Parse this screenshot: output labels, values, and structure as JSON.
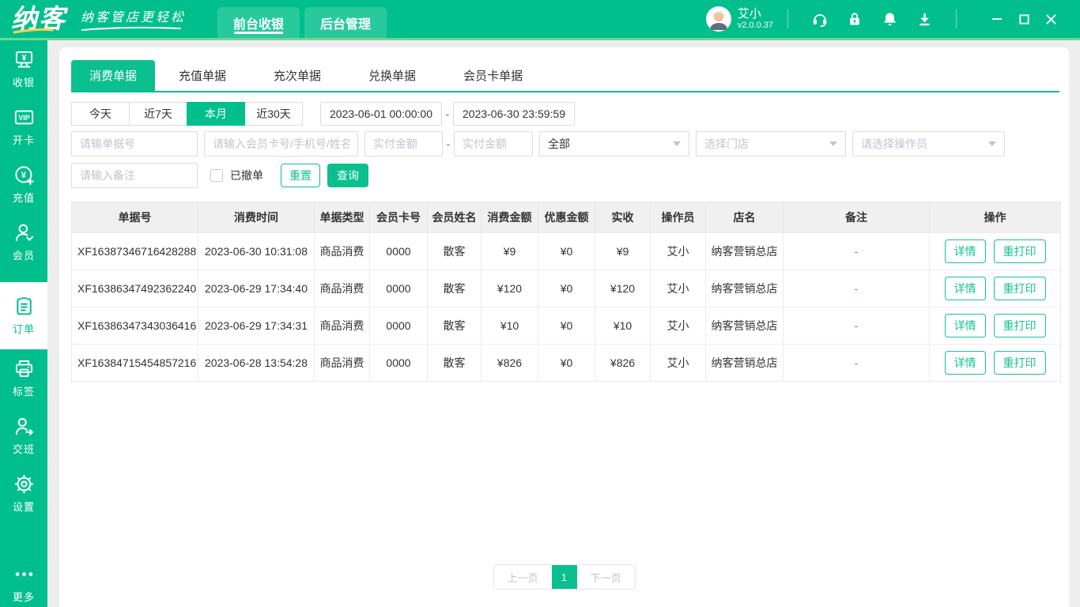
{
  "titlebar": {
    "logo": "纳客",
    "slogan": "纳客管店更轻松",
    "nav": {
      "front": "前台收银",
      "back": "后台管理"
    },
    "user": {
      "name": "艾小",
      "version": "v2.0.0.37"
    }
  },
  "sidebar": {
    "items": [
      {
        "label": "收银",
        "icon": "cash-register-icon",
        "active": false
      },
      {
        "label": "开卡",
        "icon": "vip-card-icon",
        "active": false
      },
      {
        "label": "充值",
        "icon": "recharge-icon",
        "active": false
      },
      {
        "label": "会员",
        "icon": "member-icon",
        "active": false
      },
      {
        "label": "订单",
        "icon": "order-icon",
        "active": true
      },
      {
        "label": "标签",
        "icon": "label-printer-icon",
        "active": false
      },
      {
        "label": "交班",
        "icon": "shift-icon",
        "active": false
      },
      {
        "label": "设置",
        "icon": "settings-gear-icon",
        "active": false
      },
      {
        "label": "更多",
        "icon": "more-dots-icon",
        "active": false
      }
    ]
  },
  "tabs": [
    {
      "label": "消费单据",
      "active": true
    },
    {
      "label": "充值单据",
      "active": false
    },
    {
      "label": "充次单据",
      "active": false
    },
    {
      "label": "兑换单据",
      "active": false
    },
    {
      "label": "会员卡单据",
      "active": false
    }
  ],
  "filters": {
    "quick_ranges": [
      {
        "label": "今天",
        "active": false
      },
      {
        "label": "近7天",
        "active": false
      },
      {
        "label": "本月",
        "active": true
      },
      {
        "label": "近30天",
        "active": false
      }
    ],
    "date_from": "2023-06-01 00:00:00",
    "date_to": "2023-06-30 23:59:59",
    "range_separator": "-",
    "order_no_placeholder": "请输单据号",
    "member_placeholder": "请输入会员卡号/手机号/姓名",
    "pay_min_placeholder": "实付金额",
    "pay_max_placeholder": "实付金额",
    "amount_separator": "-",
    "type_select_value": "全部",
    "store_select_placeholder": "选择门店",
    "operator_select_placeholder": "请选择操作员",
    "remark_placeholder": "请输入备注",
    "revoked_label": "已撤单",
    "revoked_checked": false,
    "reset_label": "重置",
    "query_label": "查询"
  },
  "table": {
    "columns": [
      "单据号",
      "消费时间",
      "单据类型",
      "会员卡号",
      "会员姓名",
      "消费金额",
      "优惠金额",
      "实收",
      "操作员",
      "店名",
      "备注",
      "操作"
    ],
    "actions": {
      "detail": "详情",
      "reprint": "重打印"
    },
    "rows": [
      {
        "cells": [
          "XF16387346716428288",
          "2023-06-30 10:31:08",
          "商品消费",
          "0000",
          "散客",
          "¥9",
          "¥0",
          "¥9",
          "艾小",
          "纳客营销总店",
          "-"
        ]
      },
      {
        "cells": [
          "XF16386347492362240",
          "2023-06-29 17:34:40",
          "商品消费",
          "0000",
          "散客",
          "¥120",
          "¥0",
          "¥120",
          "艾小",
          "纳客营销总店",
          "-"
        ]
      },
      {
        "cells": [
          "XF16386347343036416",
          "2023-06-29 17:34:31",
          "商品消费",
          "0000",
          "散客",
          "¥10",
          "¥0",
          "¥10",
          "艾小",
          "纳客营销总店",
          "-"
        ]
      },
      {
        "cells": [
          "XF16384715454857216",
          "2023-06-28 13:54:28",
          "商品消费",
          "0000",
          "散客",
          "¥826",
          "¥0",
          "¥826",
          "艾小",
          "纳客营销总店",
          "-"
        ]
      }
    ]
  },
  "pagination": {
    "prev": "上一页",
    "current": "1",
    "next": "下一页"
  },
  "colors": {
    "primary_green": "#00bf8c",
    "accent_green": "#0cbf8e",
    "header_underline": "#6fd98b",
    "remark_blue": "#3f8cd6",
    "page_background": "#eeeeee",
    "table_header_bg": "#f0f0f0"
  }
}
